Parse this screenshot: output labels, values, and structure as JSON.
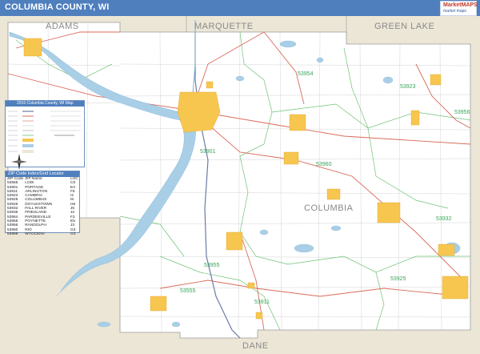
{
  "header": {
    "title": "COLUMBIA COUNTY, WI",
    "logo_text": "MarketMAPS",
    "logo_subtext": "market maps"
  },
  "colors": {
    "title_bar": "#4f7fbd",
    "water": "#a9cfe6",
    "outside_county": "#ece6d6",
    "urban": "#f7c64f",
    "zip_boundary": "#6fc276",
    "highway": "#d96a5a",
    "interstate": "#6c7ba6"
  },
  "map": {
    "counties": {
      "adams": "ADAMS",
      "marquette": "MARQUETTE",
      "green_lake": "GREEN LAKE",
      "columbia": "COLUMBIA",
      "dane": "DANE"
    },
    "zip_labels": {
      "z53954": "53954",
      "z53923": "53923",
      "z53956": "53956",
      "z53901": "53901",
      "z53960": "53960",
      "z53932": "53932",
      "z53955": "53955",
      "z53925": "53925",
      "z53555": "53555",
      "z53911": "53911"
    }
  },
  "legend": {
    "title": "2016 Columbia County, WI Map",
    "rows": [
      "",
      "",
      "",
      "",
      "",
      "",
      "",
      "",
      "",
      "",
      "",
      ""
    ]
  },
  "zip_index": {
    "title": "ZIP Code Index/Grid Locator",
    "headers": [
      "ZIP Code",
      "ZIP Name",
      "LOC"
    ],
    "rows": [
      [
        "53555",
        "LODI",
        "C6"
      ],
      [
        "53901",
        "PORTAGE",
        "E3"
      ],
      [
        "53911",
        "ARLINGTON",
        "F6"
      ],
      [
        "53923",
        "CAMBRIA",
        "I2"
      ],
      [
        "53925",
        "COLUMBUS",
        "I6"
      ],
      [
        "53926",
        "DOYLESTOWN",
        "H6"
      ],
      [
        "53932",
        "FALL RIVER",
        "J5"
      ],
      [
        "53935",
        "FRIESLAND",
        "J2"
      ],
      [
        "53954",
        "PARDEEVILLE",
        "F2"
      ],
      [
        "53955",
        "POYNETTE",
        "E5"
      ],
      [
        "53956",
        "RANDOLPH",
        "J3"
      ],
      [
        "53960",
        "RIO",
        "G3"
      ],
      [
        "53969",
        "WYOCENA",
        "G3"
      ]
    ]
  }
}
